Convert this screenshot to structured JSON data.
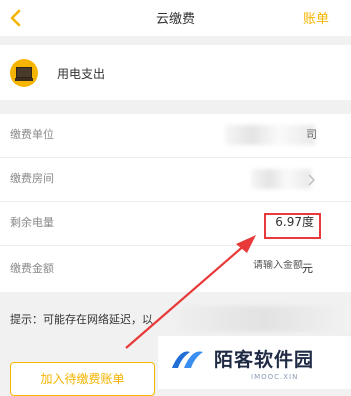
{
  "header": {
    "title": "云缴费",
    "right_label": "账单"
  },
  "bill_type": {
    "label": "用电支出"
  },
  "form": {
    "unit_label": "缴费单位",
    "unit_value_tail": "司",
    "room_label": "缴费房间",
    "remaining_label": "剩余电量",
    "remaining_value": "6.97度",
    "amount_label": "缴费金额",
    "amount_placeholder": "请输入金额",
    "amount_unit": "元"
  },
  "tip": {
    "text": "提示：可能存在网络延迟，以"
  },
  "actions": {
    "add_pending_label": "加入待缴费账单"
  },
  "watermark": {
    "title": "陌客软件园",
    "subtitle": "IMOOC.XIN"
  },
  "colors": {
    "accent": "#f5b400",
    "annotation": "#e83a3a"
  }
}
